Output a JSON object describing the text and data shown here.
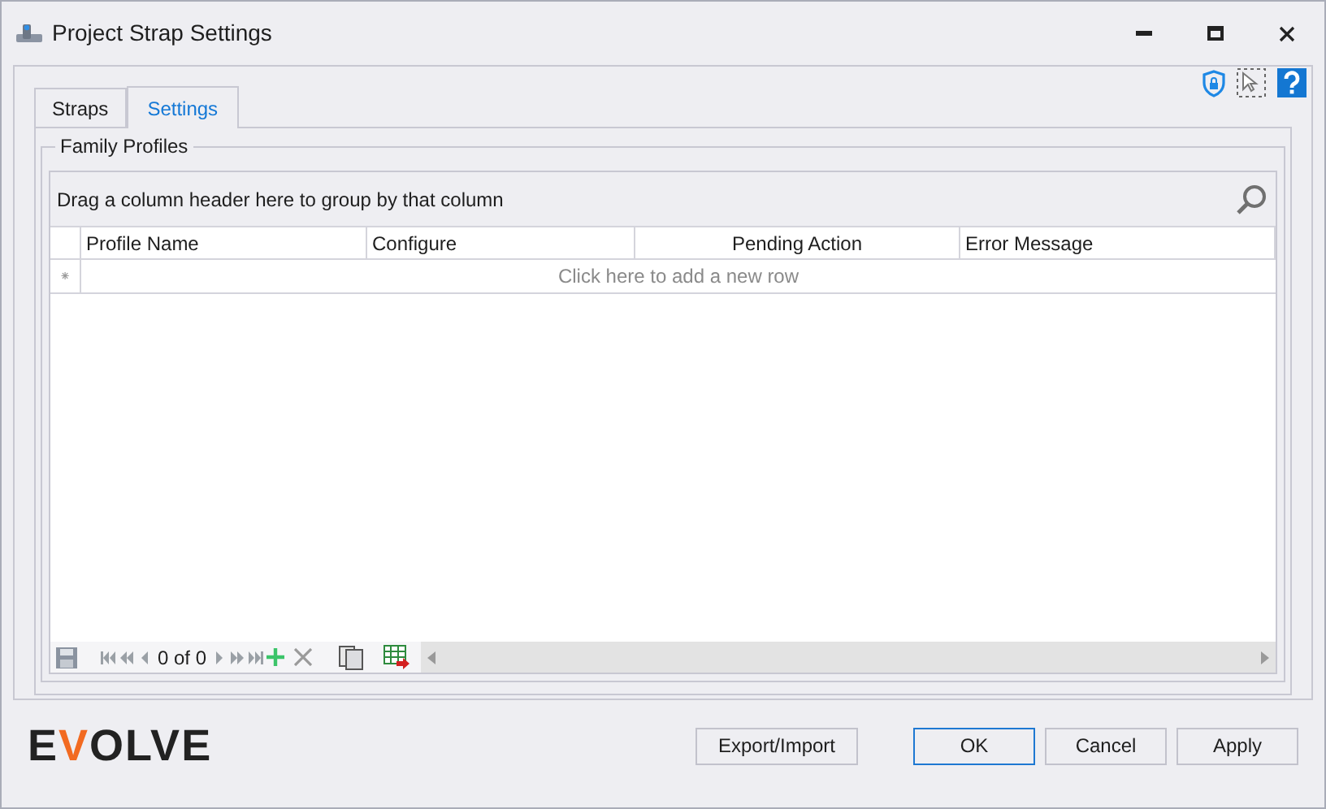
{
  "window": {
    "title": "Project Strap Settings"
  },
  "tabs": [
    {
      "label": "Straps",
      "selected": false
    },
    {
      "label": "Settings",
      "selected": true
    }
  ],
  "group": {
    "title": "Family Profiles"
  },
  "grid": {
    "group_panel": "Drag a column header here to group by that column",
    "columns": [
      {
        "label": "Profile Name"
      },
      {
        "label": "Configure"
      },
      {
        "label": "Pending Action"
      },
      {
        "label": "Error Message"
      }
    ],
    "new_row_marker": "⁕",
    "new_row": "Click here to add a new row",
    "navigator": {
      "record": "0 of 0"
    }
  },
  "logo": {
    "text": "EVOLVE"
  },
  "buttons": [
    {
      "label": "Export/Import",
      "default": false
    },
    {
      "label": "OK",
      "default": true
    },
    {
      "label": "Cancel",
      "default": false
    },
    {
      "label": "Apply",
      "default": false
    }
  ]
}
